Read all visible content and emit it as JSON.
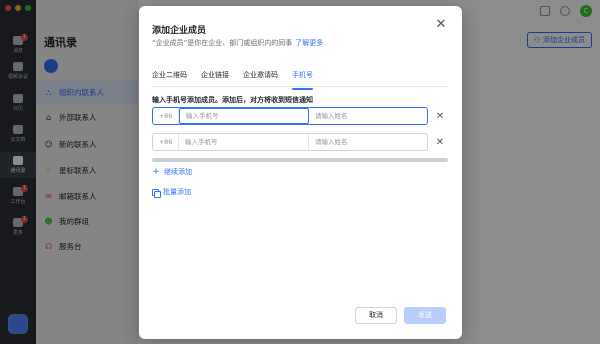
{
  "rail": {
    "items": [
      {
        "label": "消息",
        "badge": "1"
      },
      {
        "label": "视频会议",
        "badge": ""
      },
      {
        "label": "日历",
        "badge": ""
      },
      {
        "label": "云文档",
        "badge": ""
      },
      {
        "label": "通讯录",
        "badge": ""
      },
      {
        "label": "工作台",
        "badge": "1"
      },
      {
        "label": "更多",
        "badge": "1"
      }
    ]
  },
  "side": {
    "title": "通讯录",
    "items": [
      {
        "label": "组织内联系人",
        "icon": "org-icon"
      },
      {
        "label": "外部联系人",
        "icon": "external-icon"
      },
      {
        "label": "新的联系人",
        "icon": "new-contact-icon"
      },
      {
        "label": "星标联系人",
        "icon": "star-icon"
      },
      {
        "label": "邮箱联系人",
        "icon": "mail-icon"
      },
      {
        "label": "我的群组",
        "icon": "group-icon"
      },
      {
        "label": "服务台",
        "icon": "headset-icon"
      }
    ]
  },
  "main": {
    "add_member_label": "添加企业成员",
    "user_initial": "C"
  },
  "modal": {
    "title": "添加企业成员",
    "subtitle": "“企业成员”是你在企业、部门或组织内的同事",
    "learn_more": "了解更多",
    "tabs": [
      {
        "label": "企业二维码",
        "active": false
      },
      {
        "label": "企业链接",
        "active": false
      },
      {
        "label": "企业邀请码",
        "active": false
      },
      {
        "label": "手机号",
        "active": true
      }
    ],
    "instruction": "输入手机号添加成员。添加后，对方将收到短信通知",
    "rows": [
      {
        "code": "+86",
        "phone_placeholder": "输入手机号",
        "name_placeholder": "请输入姓名"
      },
      {
        "code": "+86",
        "phone_placeholder": "输入手机号",
        "name_placeholder": "请输入姓名"
      }
    ],
    "continue_add": "继续添加",
    "batch_add": "批量添加",
    "cancel": "取消",
    "send": "发送"
  },
  "colors": {
    "accent": "#3370ff",
    "rail_bg": "#2b2f36",
    "send_disabled": "#bacefd"
  }
}
